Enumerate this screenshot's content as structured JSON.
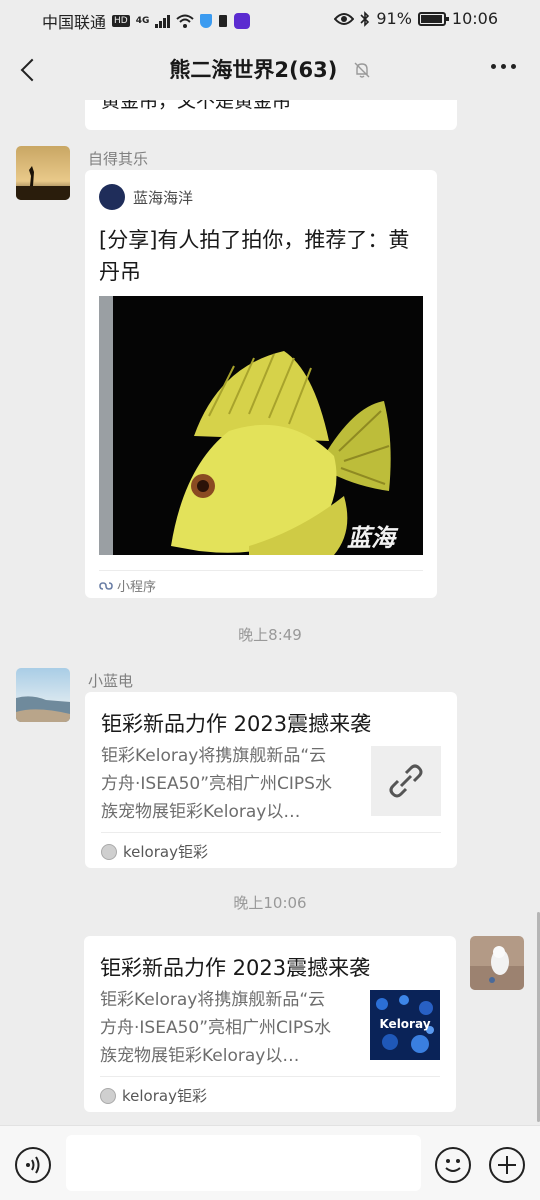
{
  "status_bar": {
    "carrier": "中国联通",
    "hd_badge": "HD",
    "network": "4G",
    "battery": "91%",
    "time": "10:06"
  },
  "header": {
    "title": "熊二海世界2(63)"
  },
  "messages": {
    "prev_text": "黄金吊，又不是黄金吊",
    "m1": {
      "sender": "自得其乐",
      "source": "蓝海海洋",
      "title": "[分享]有人拍了拍你，推荐了：黄丹吊",
      "watermark": "蓝海",
      "footer": "小程序"
    },
    "time1": "晚上8:49",
    "m2": {
      "sender": "小蓝电",
      "title": "钜彩新品力作 2023震撼来袭",
      "desc": "钜彩Keloray将携旗舰新品“云方舟·ISEA50”亮相广州CIPS水族宠物展钜彩Keloray以…",
      "source": "keloray钜彩"
    },
    "time2": "晚上10:06",
    "m3": {
      "title": "钜彩新品力作 2023震撼来袭",
      "desc": "钜彩Keloray将携旗舰新品“云方舟·ISEA50”亮相广州CIPS水族宠物展钜彩Keloray以…",
      "thumb_text": "Keloray",
      "source": "keloray钜彩"
    }
  },
  "input": {
    "placeholder": ""
  }
}
